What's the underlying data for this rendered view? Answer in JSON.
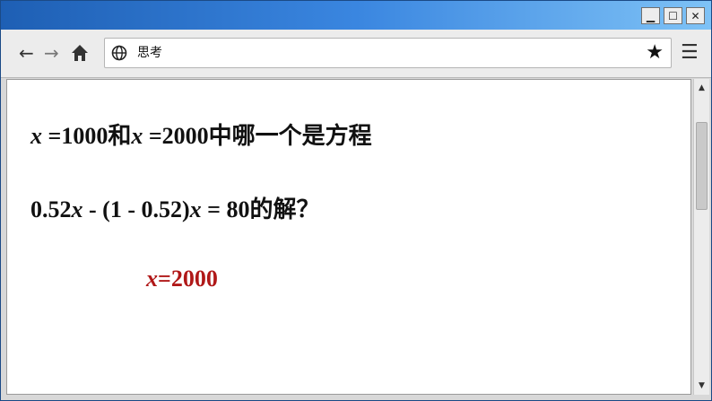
{
  "window": {
    "controls": {
      "minimize": "▁",
      "maximize": "☐",
      "close": "✕"
    }
  },
  "toolbar": {
    "back_icon": "←",
    "forward_icon": "→",
    "home_icon": "home-icon",
    "address": "思考",
    "bookmark_icon": "★",
    "menu_icon": "☰"
  },
  "question": {
    "line1": {
      "var1": "x",
      "part1": " =1000和",
      "var2": "x",
      "part2": " =2000中哪一个是方程"
    },
    "line2": {
      "part1": "0.52",
      "var1": "x",
      "part2": " - (1 - 0.52)",
      "var2": "x",
      "part3": " = 80的解？"
    }
  },
  "answer": {
    "var": "x",
    "value": "=2000"
  },
  "scrollbar": {
    "up": "▲",
    "down": "▼"
  }
}
